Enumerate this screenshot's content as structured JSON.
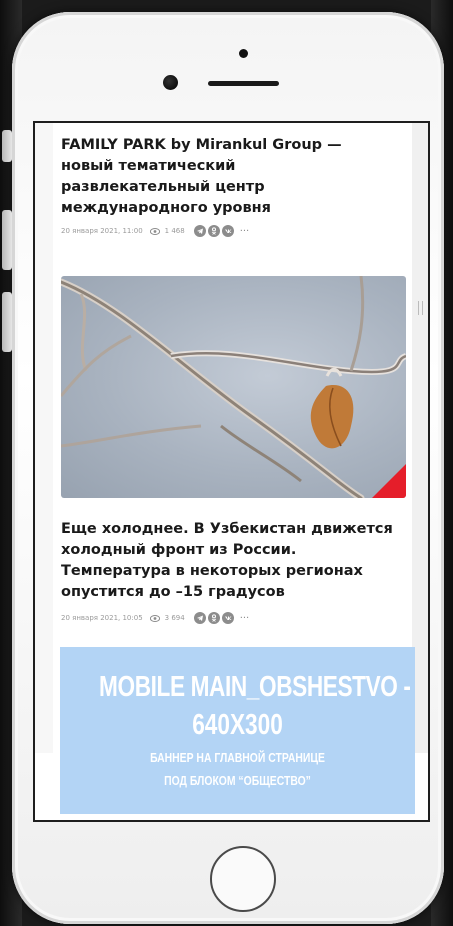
{
  "articles": [
    {
      "title_lines": [
        "FAMILY PARK by Mirankul Group —",
        "новый тематический",
        "развлекательный центр",
        "международного уровня"
      ],
      "date": "20 января 2021, 11:00",
      "views": "1 468"
    },
    {
      "title_lines": [
        "Еще холоднее. В Узбекистан движется",
        "холодный фронт из России.",
        "Температура в некоторых регионах",
        "опустится до –15 градусов"
      ],
      "date": "20 января 2021, 10:05",
      "views": "3 694",
      "image_icon": "frost-branch-leaf-photo"
    }
  ],
  "share_icons": [
    "telegram-icon",
    "odnoklassniki-icon",
    "vk-icon"
  ],
  "more_label": "···",
  "banner": {
    "line1": "MOBILE MAIN_OBSHESTVO -",
    "line2": "640X300",
    "line3": "БАННЕР НА ГЛАВНОЙ СТРАНИЦЕ",
    "line4": "ПОД БЛОКОМ “ОБЩЕСТВО”",
    "bg_color": "#b3d4f5"
  },
  "colors": {
    "accent_corner": "#e51e2a",
    "meta_gray": "#9a9a9a"
  }
}
